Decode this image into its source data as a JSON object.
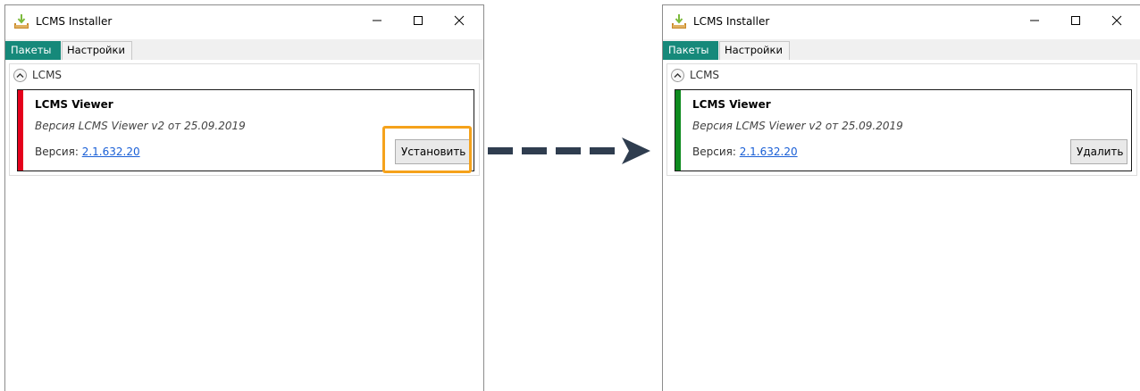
{
  "left_window": {
    "title": "LCMS Installer",
    "tabs": [
      "Пакеты",
      "Настройки"
    ],
    "group_label": "LCMS",
    "card": {
      "title": "LCMS Viewer",
      "description": "Версия LCMS Viewer v2 от 25.09.2019",
      "version_label": "Версия: ",
      "version_value": "2.1.632.20",
      "status_color": "#e4001b",
      "action_label": "Установить"
    }
  },
  "right_window": {
    "title": "LCMS Installer",
    "tabs": [
      "Пакеты",
      "Настройки"
    ],
    "group_label": "LCMS",
    "card": {
      "title": "LCMS Viewer",
      "description": "Версия LCMS Viewer v2 от 25.09.2019",
      "version_label": "Версия: ",
      "version_value": "2.1.632.20",
      "status_color": "#0e8a1e",
      "action_label": "Удалить"
    }
  },
  "colors": {
    "accent_tab": "#16897a",
    "highlight": "#f5a21b",
    "link": "#1a5fd6",
    "arrow": "#2f3d4f"
  },
  "icons": {
    "app": "installer-download-icon",
    "minimize": "minimize-icon",
    "maximize": "maximize-icon",
    "close": "close-icon",
    "collapse": "chevron-up-icon",
    "transition": "dashed-arrow-right-icon"
  }
}
